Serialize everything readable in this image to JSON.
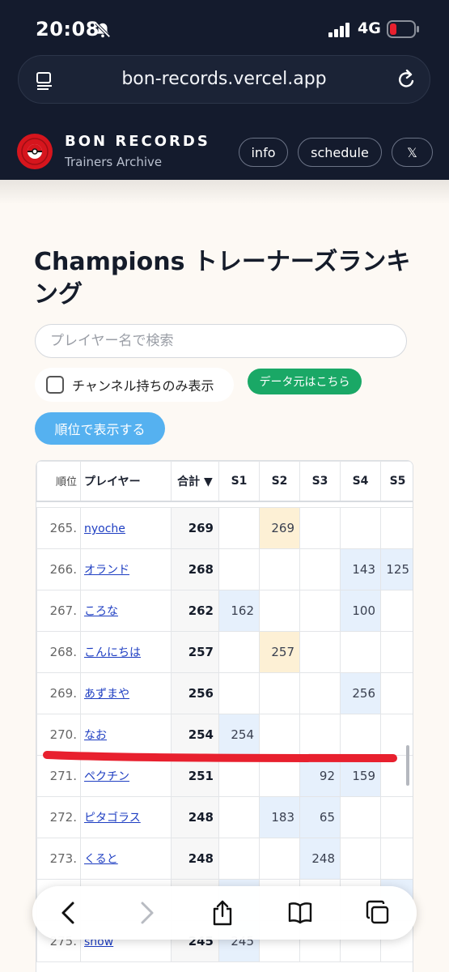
{
  "status": {
    "time": "20:08",
    "network": "4G"
  },
  "browser": {
    "url": "bon-records.vercel.app"
  },
  "site": {
    "brand": "BON RECORDS",
    "subtitle": "Trainers Archive",
    "nav": {
      "info": "info",
      "schedule": "schedule",
      "x": "𝕏"
    }
  },
  "page": {
    "title": "Champions トレーナーズランキング",
    "search_placeholder": "プレイヤー名で検索",
    "channel_filter_label": "チャンネル持ちのみ表示",
    "source_button": "データ元はこちら",
    "rank_button": "順位で表示する"
  },
  "table": {
    "headers": {
      "rank": "順位",
      "player": "プレイヤー",
      "total": "合計 ▼",
      "s1": "S1",
      "s2": "S2",
      "s3": "S3",
      "s4": "S4",
      "s5": "S5"
    },
    "rows": [
      {
        "rank": "265.",
        "player": "nyoche",
        "total": "269",
        "s1": "",
        "s2": "269",
        "s3": "",
        "s4": "",
        "s5": ""
      },
      {
        "rank": "266.",
        "player": "オランド",
        "total": "268",
        "s1": "",
        "s2": "",
        "s3": "",
        "s4": "143",
        "s5": "125"
      },
      {
        "rank": "267.",
        "player": "ころな",
        "total": "262",
        "s1": "162",
        "s2": "",
        "s3": "",
        "s4": "100",
        "s5": ""
      },
      {
        "rank": "268.",
        "player": "こんにちは",
        "total": "257",
        "s1": "",
        "s2": "257",
        "s3": "",
        "s4": "",
        "s5": ""
      },
      {
        "rank": "269.",
        "player": "あずまや",
        "total": "256",
        "s1": "",
        "s2": "",
        "s3": "",
        "s4": "256",
        "s5": ""
      },
      {
        "rank": "270.",
        "player": "なお",
        "total": "254",
        "s1": "254",
        "s2": "",
        "s3": "",
        "s4": "",
        "s5": ""
      },
      {
        "rank": "271.",
        "player": "ペクチン",
        "total": "251",
        "s1": "",
        "s2": "",
        "s3": "92",
        "s4": "159",
        "s5": ""
      },
      {
        "rank": "272.",
        "player": "ピタゴラス",
        "total": "248",
        "s1": "",
        "s2": "183",
        "s3": "65",
        "s4": "",
        "s5": ""
      },
      {
        "rank": "273.",
        "player": "くると",
        "total": "248",
        "s1": "",
        "s2": "",
        "s3": "248",
        "s4": "",
        "s5": ""
      },
      {
        "rank": "275.",
        "player": "snow",
        "total": "245",
        "s1": "245",
        "s2": "",
        "s3": "",
        "s4": "",
        "s5": ""
      }
    ]
  },
  "colors": {
    "dark_header": "#141b2d",
    "accent_blue": "#55b1f0",
    "accent_green": "#1aa866",
    "annotation_red": "#e8202e",
    "cell_blue": "#e6f0fc",
    "cell_yellow": "#fdf0d5"
  }
}
